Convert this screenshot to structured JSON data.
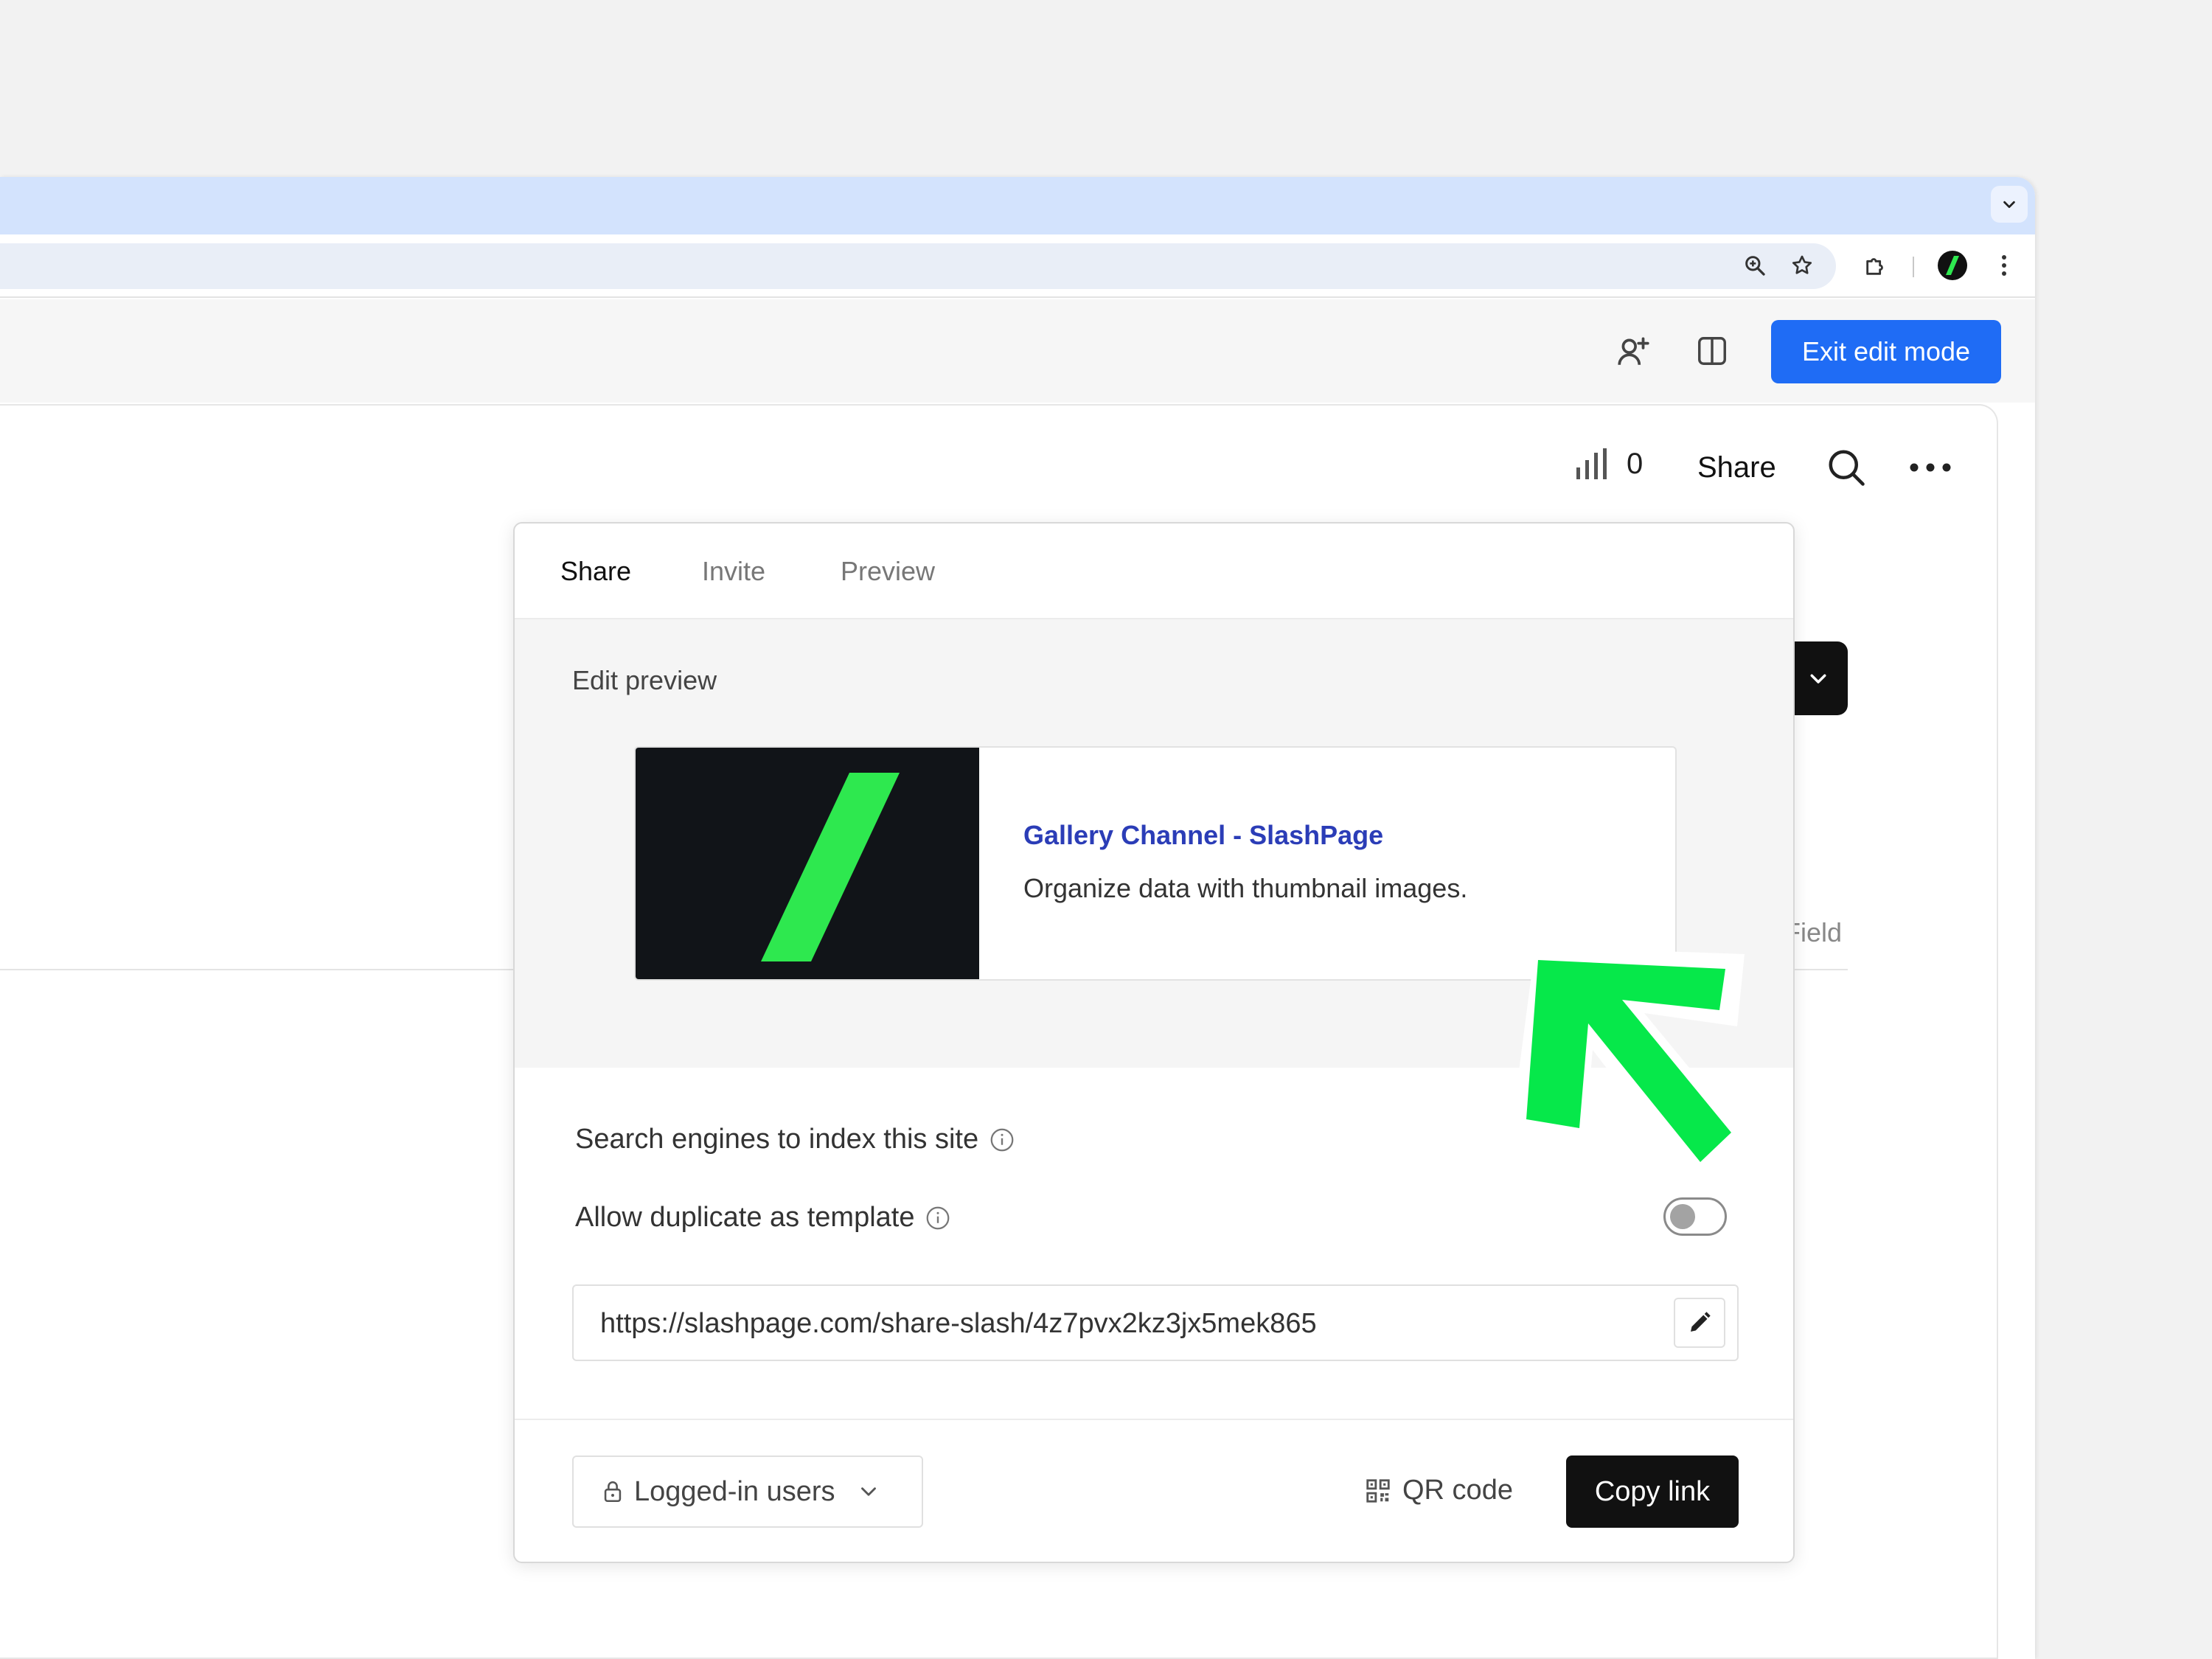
{
  "browser": {
    "tabstrip_dropdown_icon": "chevron-down-icon",
    "toolbar_icons": [
      "zoom-icon",
      "bookmark-star-icon",
      "extensions-puzzle-icon",
      "profile-avatar-icon",
      "kebab-menu-icon"
    ]
  },
  "appbar": {
    "invite_icon": "person-add-icon",
    "layout_icon": "split-panel-icon",
    "exit_label": "Exit edit mode"
  },
  "page": {
    "view_count": "0",
    "share_label": "Share",
    "field_label": "Field"
  },
  "popover": {
    "tabs": [
      {
        "label": "Share",
        "active": true
      },
      {
        "label": "Invite",
        "active": false
      },
      {
        "label": "Preview",
        "active": false
      }
    ],
    "edit_preview_label": "Edit preview",
    "card": {
      "title": "Gallery Channel - SlashPage",
      "description": "Organize data with thumbnail images."
    },
    "settings": [
      {
        "label": "Search engines to index this site"
      },
      {
        "label": "Allow duplicate as template",
        "toggle_on": false
      }
    ],
    "url": "https://slashpage.com/share-slash/4z7pvx2kz3jx5mek865",
    "access_label": "Logged-in users",
    "qr_label": "QR code",
    "copy_label": "Copy link"
  },
  "colors": {
    "accent_blue": "#1f6cf5",
    "brand_green": "#2ee84f",
    "arrow_green": "#06e84a",
    "link_blue": "#2b3db7"
  }
}
